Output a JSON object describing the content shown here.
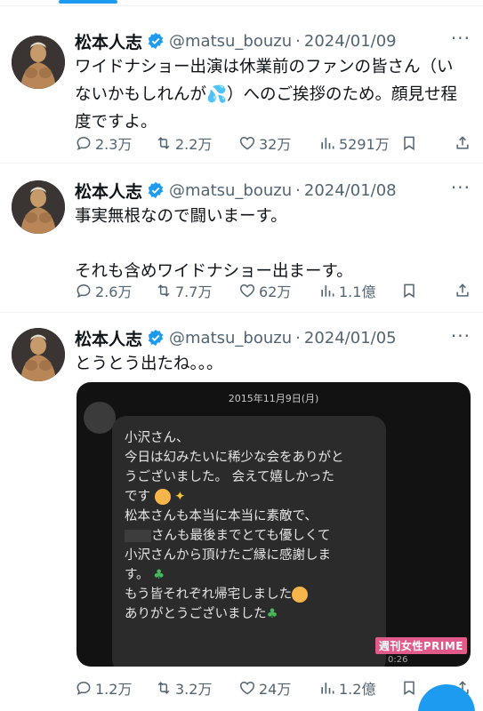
{
  "tweets": [
    {
      "name": "松本人志",
      "handle": "@matsu_bouzu",
      "dot": "·",
      "date": "2024/01/09",
      "text": "ワイドナショー出演は休業前のファンの皆さん（いないかもしれんが💦）へのご挨拶のため。顔見せ程度ですよ。",
      "replies": "2.3万",
      "retweets": "2.2万",
      "likes": "32万",
      "views": "5291万"
    },
    {
      "name": "松本人志",
      "handle": "@matsu_bouzu",
      "dot": "·",
      "date": "2024/01/08",
      "text": "事実無根なので闘いまーす。\n\nそれも含めワイドナショー出まーす。",
      "replies": "2.6万",
      "retweets": "7.7万",
      "likes": "62万",
      "views": "1.1億"
    },
    {
      "name": "松本人志",
      "handle": "@matsu_bouzu",
      "dot": "·",
      "date": "2024/01/05",
      "text": "とうとう出たね。。。",
      "replies": "1.2万",
      "retweets": "3.2万",
      "likes": "24万",
      "views": "1.2億",
      "media": {
        "date_header": "2015年11月9日(月)",
        "lines": [
          "小沢さん、",
          "今日は幻みたいに稀少な会をありがと",
          "うございました。 会えて嬉しかった",
          "です",
          "",
          "松本さんも本当に本当に素敵で、",
          "さんも最後までとても優しくて",
          "小沢さんから頂けたご縁に感謝しま",
          "す。",
          "",
          "もう皆それぞれ帰宅しました",
          "ありがとうございました"
        ],
        "watermark": "週刊女性PRIME",
        "duration": "0:26"
      }
    }
  ],
  "icons": {
    "more": "more-horizontal-icon",
    "reply": "reply-icon",
    "retweet": "retweet-icon",
    "like": "heart-icon",
    "views": "views-icon",
    "bookmark": "bookmark-icon",
    "share": "share-icon",
    "verified": "verified-badge-icon",
    "compose": "compose-fab"
  },
  "colors": {
    "accent": "#1d9bf0",
    "muted": "#536471",
    "text": "#0f1419",
    "divider": "#eff3f4"
  }
}
